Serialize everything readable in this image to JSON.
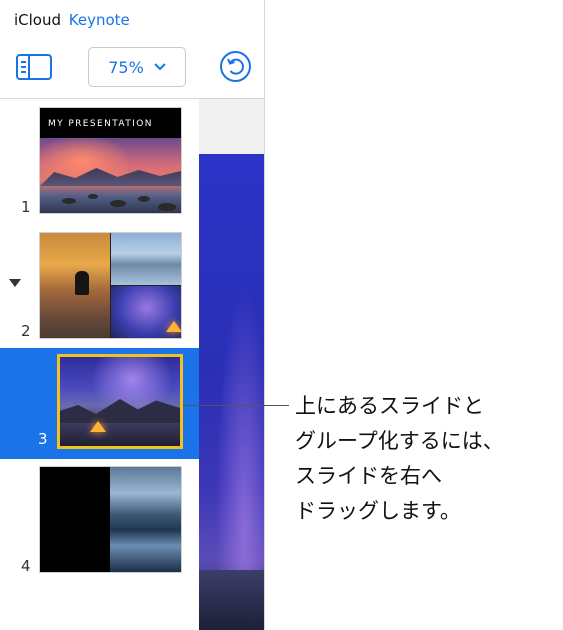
{
  "header": {
    "brand": "iCloud",
    "app_name": "Keynote",
    "zoom_label": "75%"
  },
  "slide_navigator": {
    "slides": [
      {
        "number": "1",
        "title": "MY PRESENTATION"
      },
      {
        "number": "2"
      },
      {
        "number": "3",
        "selected": true
      },
      {
        "number": "4"
      }
    ]
  },
  "colors": {
    "accent": "#1a73e8",
    "selection_border": "#f2c11d"
  },
  "callout": {
    "lines": [
      "上にあるスライドと",
      "グループ化するには、",
      "スライドを右へ",
      "ドラッグします。"
    ]
  }
}
